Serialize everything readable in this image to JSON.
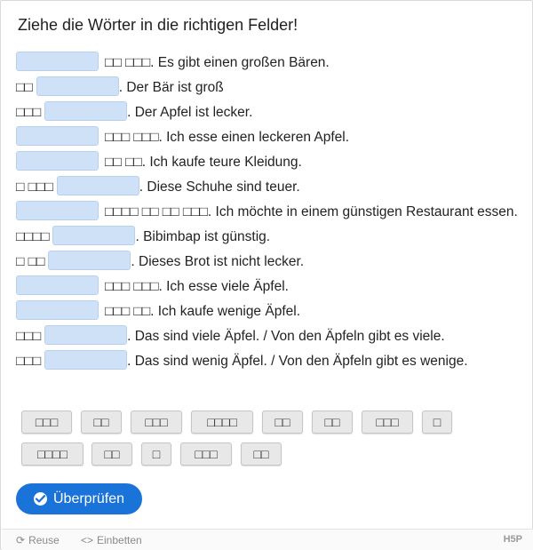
{
  "title": "Ziehe die Wörter in die richtigen Felder!",
  "sentences": [
    {
      "pre": "",
      "post": "□□ □□□. Es gibt einen großen Bären."
    },
    {
      "pre": "□□",
      "post": ". Der Bär ist groß"
    },
    {
      "pre": "□□□",
      "post": ". Der Apfel ist lecker."
    },
    {
      "pre": "",
      "post": "□□□ □□□. Ich esse einen leckeren Apfel."
    },
    {
      "pre": "",
      "post": "□□ □□. Ich kaufe teure Kleidung."
    },
    {
      "pre": "□ □□□",
      "post": ". Diese Schuhe sind teuer."
    },
    {
      "pre": "",
      "post": "□□□□ □□ □□ □□□. Ich möchte in einem günstigen Restaurant essen."
    },
    {
      "pre": "□□□□",
      "post": ". Bibimbap ist günstig."
    },
    {
      "pre": "□ □□",
      "post": ". Dieses Brot ist nicht lecker."
    },
    {
      "pre": "",
      "post": "□□□ □□□. Ich esse viele Äpfel."
    },
    {
      "pre": "",
      "post": "□□□ □□. Ich kaufe wenige Äpfel."
    },
    {
      "pre": "□□□",
      "post": ". Das sind viele Äpfel. / Von den Äpfeln gibt es viele."
    },
    {
      "pre": "□□□",
      "post": ". Das sind wenig Äpfel. / Von den Äpfeln gibt es wenige."
    }
  ],
  "word_pool": [
    "□□□",
    "□□",
    "□□□",
    "□□□□",
    "□□",
    "□□",
    "□□□",
    "□",
    "□□□□",
    "□□",
    "□",
    "□□□",
    "□□"
  ],
  "check_button": "Überprüfen",
  "footer": {
    "reuse": "Reuse",
    "embed": "Einbetten",
    "logo": "H5P"
  },
  "colors": {
    "accent": "#1a73d9",
    "gap": "#cfe1f7",
    "chip": "#e8e8e8"
  },
  "icons": {
    "check": "check-circle-icon",
    "reuse": "reuse-icon",
    "embed": "code-icon"
  }
}
